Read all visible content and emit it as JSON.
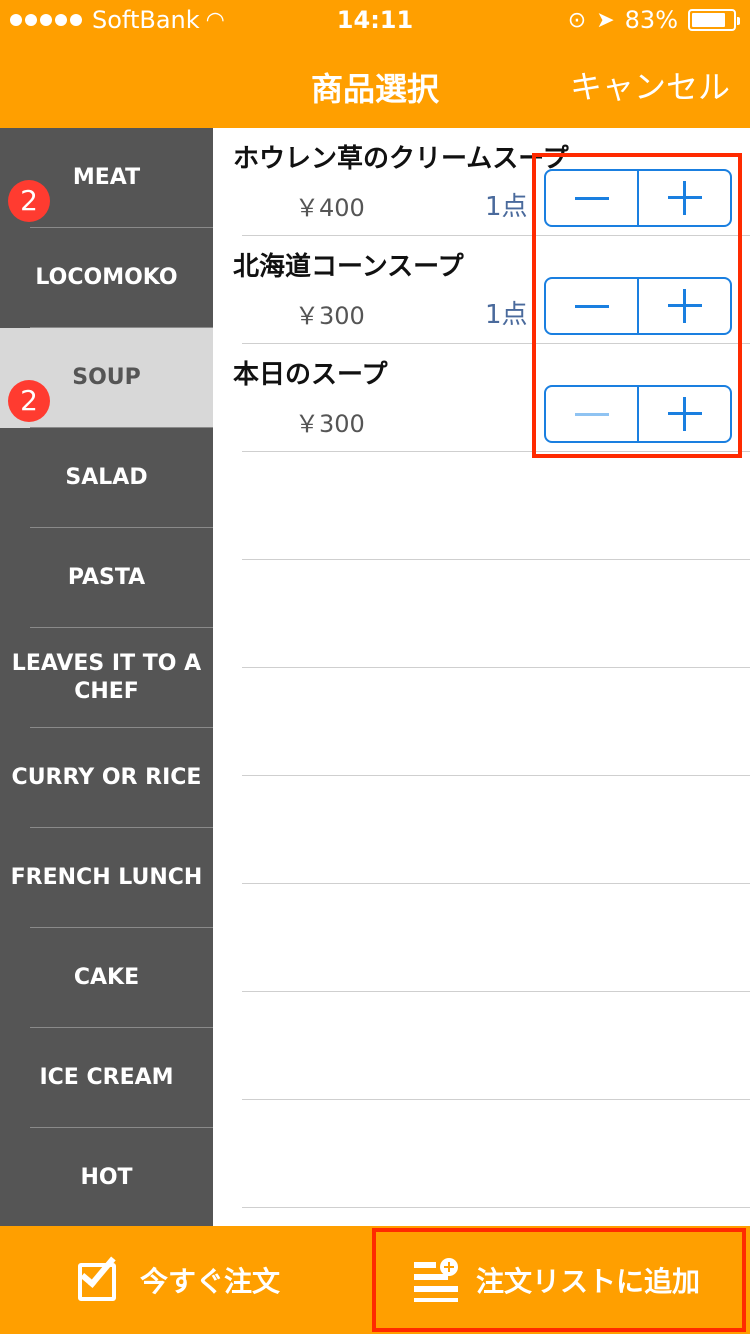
{
  "status_bar": {
    "carrier": "SoftBank",
    "time": "14:11",
    "battery": "83%",
    "battery_level": 0.83
  },
  "nav": {
    "title": "商品選択",
    "cancel_label": "キャンセル"
  },
  "categories": [
    {
      "label": "MEAT",
      "badge": "2"
    },
    {
      "label": "LOCOMOKO"
    },
    {
      "label": "SOUP",
      "badge": "2",
      "selected": true
    },
    {
      "label": "SALAD"
    },
    {
      "label": "PASTA"
    },
    {
      "label": "LEAVES IT TO A CHEF"
    },
    {
      "label": "CURRY OR RICE"
    },
    {
      "label": "FRENCH LUNCH"
    },
    {
      "label": "CAKE"
    },
    {
      "label": "ICE CREAM"
    },
    {
      "label": "HOT"
    }
  ],
  "products": [
    {
      "name": "ホウレン草のクリームスープ",
      "price": "￥400",
      "qty": "1点",
      "minus_enabled": true
    },
    {
      "name": "北海道コーンスープ",
      "price": "￥300",
      "qty": "1点",
      "minus_enabled": true
    },
    {
      "name": "本日のスープ",
      "price": "￥300",
      "qty": "",
      "minus_enabled": false
    }
  ],
  "toolbar": {
    "order_now_label": "今すぐ注文",
    "add_to_list_label": "注文リストに追加"
  },
  "colors": {
    "brand": "#ff9f00",
    "sidebar": "#555555",
    "accent": "#1a7fe0",
    "badge": "#ff3b30",
    "highlight": "#ff2a00"
  }
}
